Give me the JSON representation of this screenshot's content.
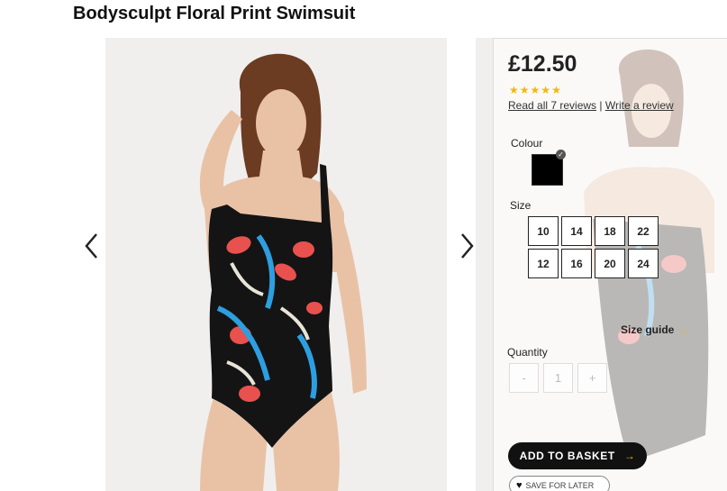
{
  "product": {
    "title": "Bodysculpt Floral Print Swimsuit",
    "price": "£12.50",
    "rating_stars": 5,
    "reviews_link": "Read all 7 reviews",
    "review_separator": "|",
    "write_review_link": "Write a review"
  },
  "gallery": {
    "prev_icon": "chevron-left-icon",
    "next_icon": "chevron-right-icon"
  },
  "options": {
    "colour_label": "Colour",
    "selected_colour": "#000000",
    "size_label": "Size",
    "sizes": [
      "10",
      "14",
      "18",
      "22",
      "12",
      "16",
      "20",
      "24"
    ],
    "size_guide_label": "Size guide",
    "size_guide_arrow": "→"
  },
  "quantity": {
    "label": "Quantity",
    "minus": "-",
    "value": "1",
    "plus": "+"
  },
  "actions": {
    "add_to_basket": "ADD TO BASKET",
    "add_arrow": "→",
    "save_for_later": "SAVE FOR LATER"
  },
  "colors": {
    "star": "#f5b800",
    "accent": "#f5b800",
    "button": "#111111"
  }
}
